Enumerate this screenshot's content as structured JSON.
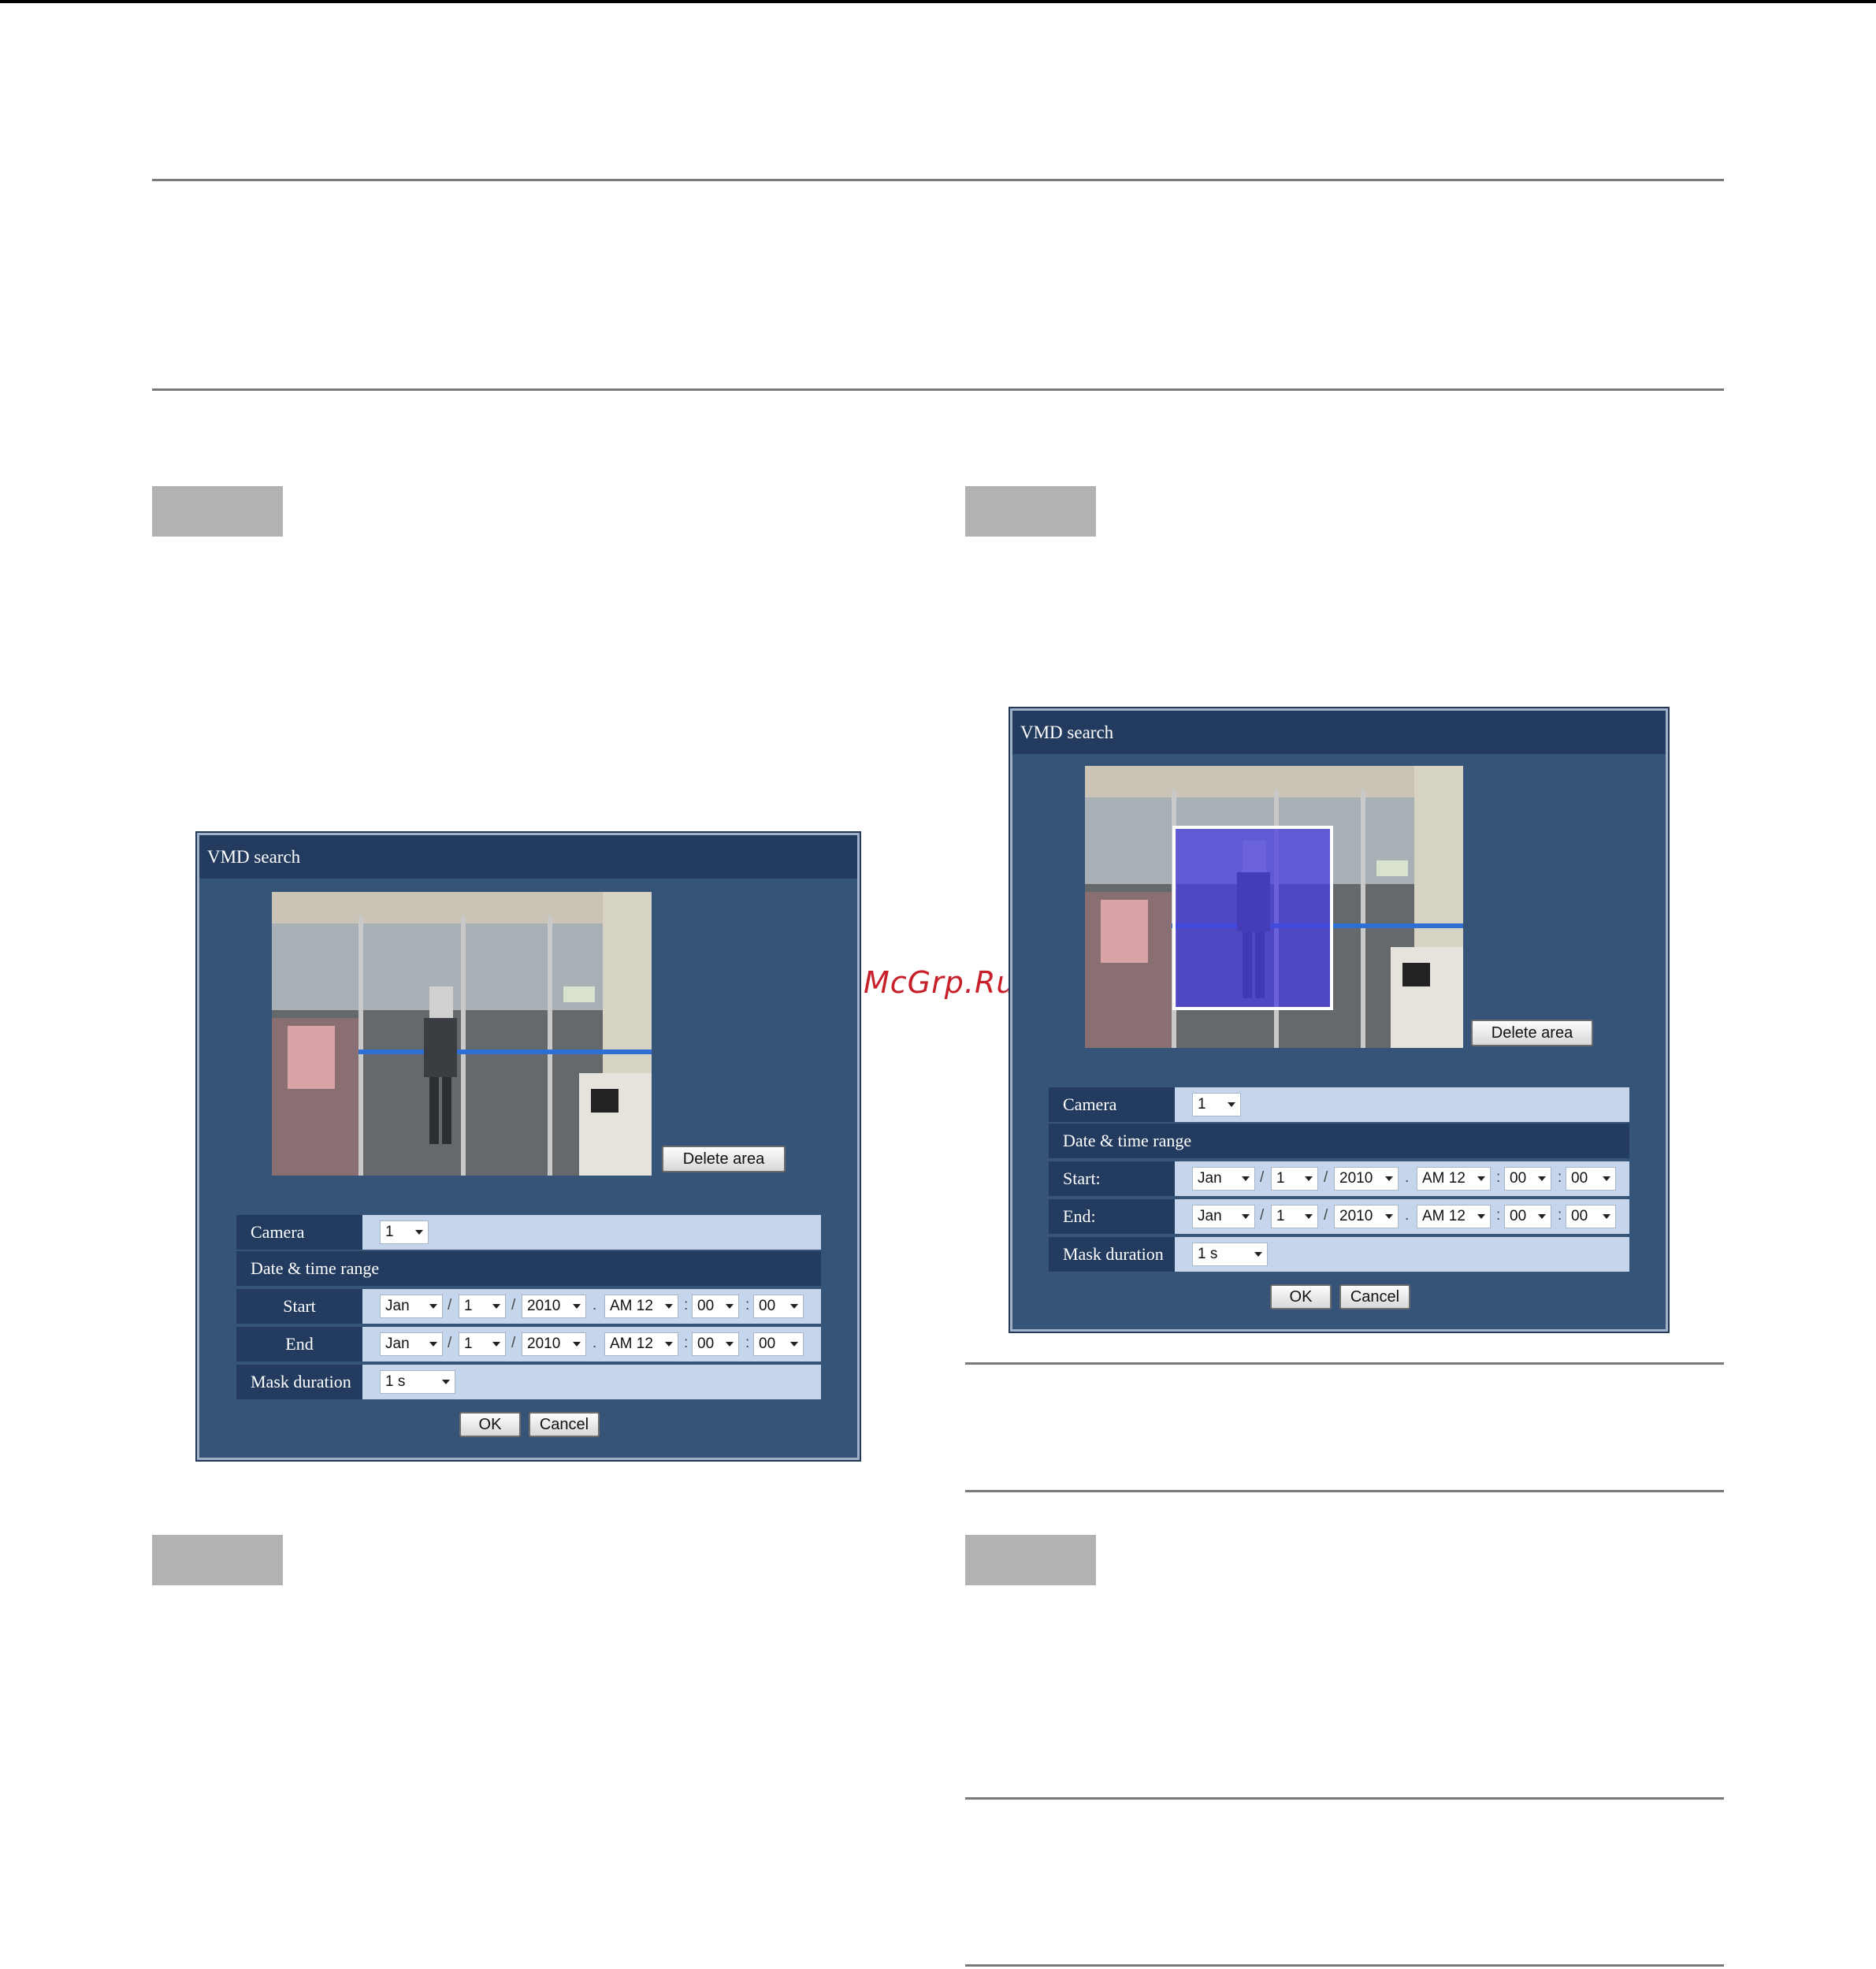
{
  "watermark": "McGrp.Ru",
  "dialog": {
    "title": "VMD search",
    "delete_area": "Delete area",
    "camera_label": "Camera",
    "camera_value": "1",
    "date_range_label": "Date & time range",
    "mask_label": "Mask duration",
    "mask_value": "1 s",
    "ok": "OK",
    "cancel": "Cancel",
    "month": "Jan",
    "day": "1",
    "year": "2010",
    "hour": "AM 12",
    "minute": "00",
    "second": "00",
    "slash": "/",
    "dot": ".",
    "colon": ":"
  },
  "left_dialog": {
    "start_label": "Start",
    "end_label": "End"
  },
  "right_dialog": {
    "start_label": "Start:",
    "end_label": "End:"
  }
}
